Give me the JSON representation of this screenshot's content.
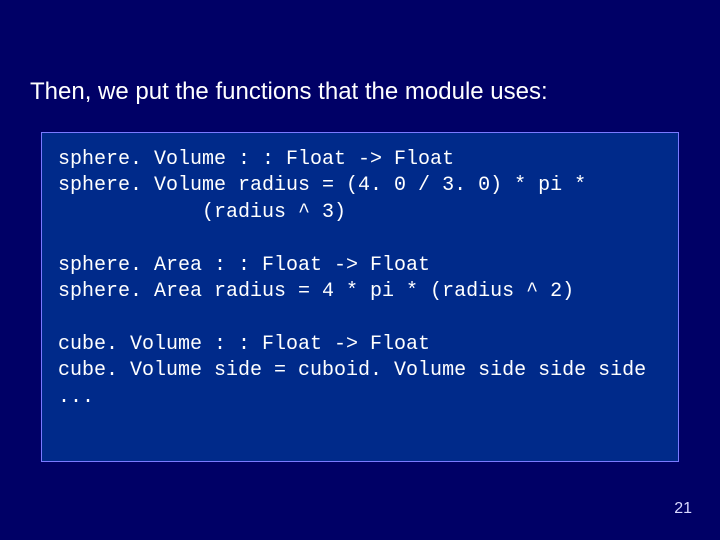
{
  "title": "Then, we put the functions that the module uses:",
  "code": "sphere. Volume : : Float -> Float\nsphere. Volume radius = (4. 0 / 3. 0) * pi *\n            (radius ^ 3)\n\nsphere. Area : : Float -> Float\nsphere. Area radius = 4 * pi * (radius ^ 2)\n\ncube. Volume : : Float -> Float\ncube. Volume side = cuboid. Volume side side side\n...",
  "page_number": "21"
}
